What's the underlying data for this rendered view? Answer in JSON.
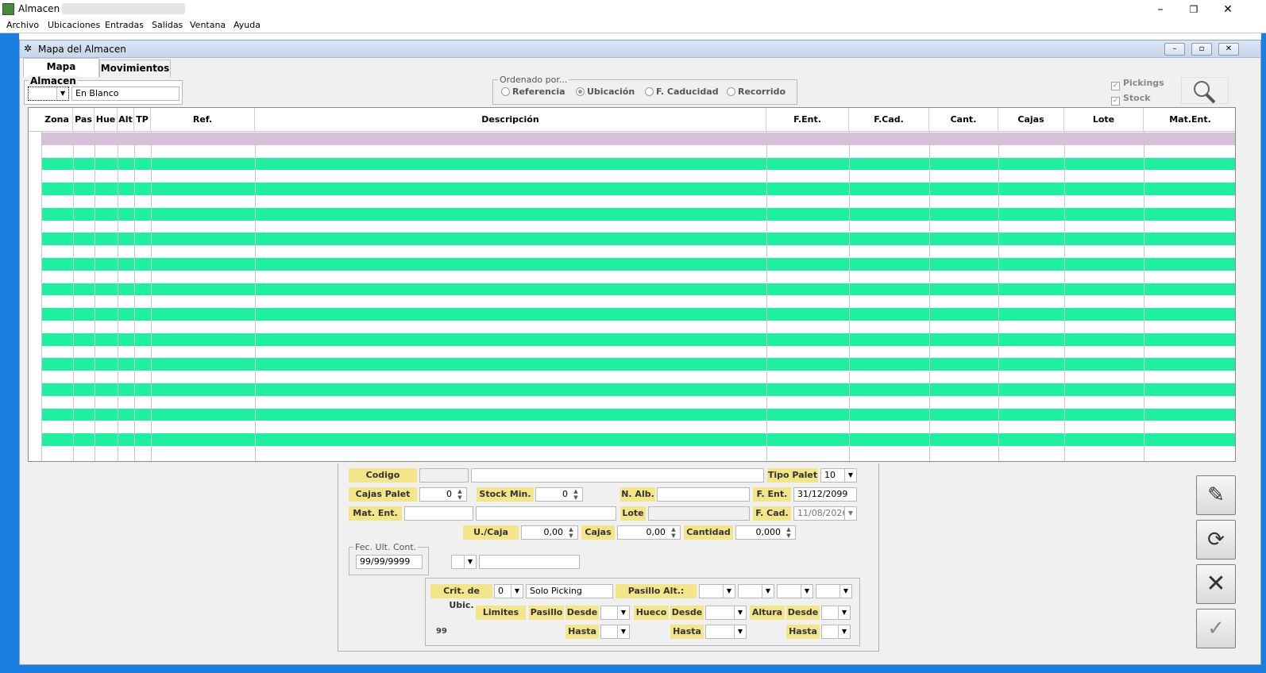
{
  "app": {
    "title": "Almacen -"
  },
  "window_controls": {
    "minimize": "–",
    "maximize": "❐",
    "close": "✕"
  },
  "menu": [
    "Archivo",
    "Ubicaciones",
    "Entradas",
    "Salidas",
    "Ventana",
    "Ayuda"
  ],
  "child": {
    "title": "Mapa del Almacen",
    "controls": {
      "minimize": "–",
      "restore": "▫",
      "close": "✕"
    }
  },
  "tabs": [
    {
      "label": "Mapa"
    },
    {
      "label": "Movimientos"
    }
  ],
  "almacen": {
    "label": "Almacen",
    "name": "En Blanco"
  },
  "ordenado": {
    "label": "Ordenado por...",
    "options": [
      "Referencia",
      "Ubicación",
      "F. Caducidad",
      "Recorrido"
    ],
    "selected": "Ubicación"
  },
  "checks": {
    "pickings": "Pickings",
    "stock": "Stock"
  },
  "grid": {
    "columns": [
      "Zona",
      "Pas",
      "Hue",
      "Alt",
      "TP",
      "Ref.",
      "Descripción",
      "F.Ent.",
      "F.Cad.",
      "Cant.",
      "Cajas",
      "Lote",
      "Mat.Ent."
    ],
    "row_colors": {
      "selected": "#d6c1d8",
      "alt": "#1ff0a0",
      "plain": "#ffffff"
    }
  },
  "form": {
    "codigo": "Codigo",
    "tipo_palet": "Tipo Palet",
    "tipo_palet_val": "10",
    "cajas_palet": "Cajas Palet",
    "cajas_palet_val": "0",
    "stock_min": "Stock Min.",
    "stock_min_val": "0",
    "n_alb": "N. Alb.",
    "f_ent": "F. Ent.",
    "f_ent_val": "31/12/2099",
    "mat_ent": "Mat. Ent.",
    "lote": "Lote",
    "f_cad": "F. Cad.",
    "f_cad_val": "11/08/2026",
    "u_caja": "U./Caja",
    "u_caja_val": "0,00",
    "cajas": "Cajas",
    "cajas_val": "0,00",
    "cantidad": "Cantidad",
    "cantidad_val": "0,000",
    "fec_ult_cont": "Fec. Ult. Cont.",
    "fec_ult_cont_val": "99/99/9999",
    "crit_ubic": "Crit. de Ubic.",
    "crit_ubic_val": "0",
    "crit_ubic_text": "Solo Picking",
    "pasillo_alt": "Pasillo  Alt.:",
    "limites": "Limites",
    "pasillo": "Pasillo",
    "desde": "Desde",
    "hasta": "Hasta",
    "hueco": "Hueco",
    "altura": "Altura",
    "counter": "99"
  }
}
